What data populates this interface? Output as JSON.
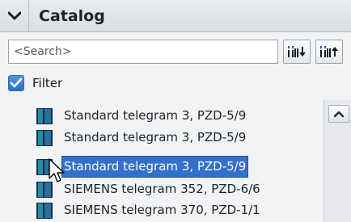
{
  "header": {
    "title": "Catalog"
  },
  "search": {
    "placeholder": "<Search>"
  },
  "filter": {
    "label": "Filter",
    "checked": true
  },
  "items": [
    {
      "label": "Standard telegram 3, PZD-5/9",
      "selected": false
    },
    {
      "label": "Standard telegram 3, PZD-5/9",
      "selected": false
    },
    {
      "label": "Standard telegram 3, PZD-5/9",
      "selected": true
    },
    {
      "label": "SIEMENS telegram 352, PZD-6/6",
      "selected": false
    },
    {
      "label": "SIEMENS telegram 370, PZD-1/1",
      "selected": false
    }
  ],
  "icons": {
    "collapse": "chevron-down-icon",
    "search_down": "search-down-icon",
    "search_up": "search-up-icon",
    "module": "module-icon",
    "scroll_up": "arrow-up-icon",
    "cursor": "pointer-cursor-icon"
  },
  "colors": {
    "selection": "#3370cc",
    "icon_teal": "#1f8fa3",
    "icon_dark": "#1c2b4a"
  }
}
